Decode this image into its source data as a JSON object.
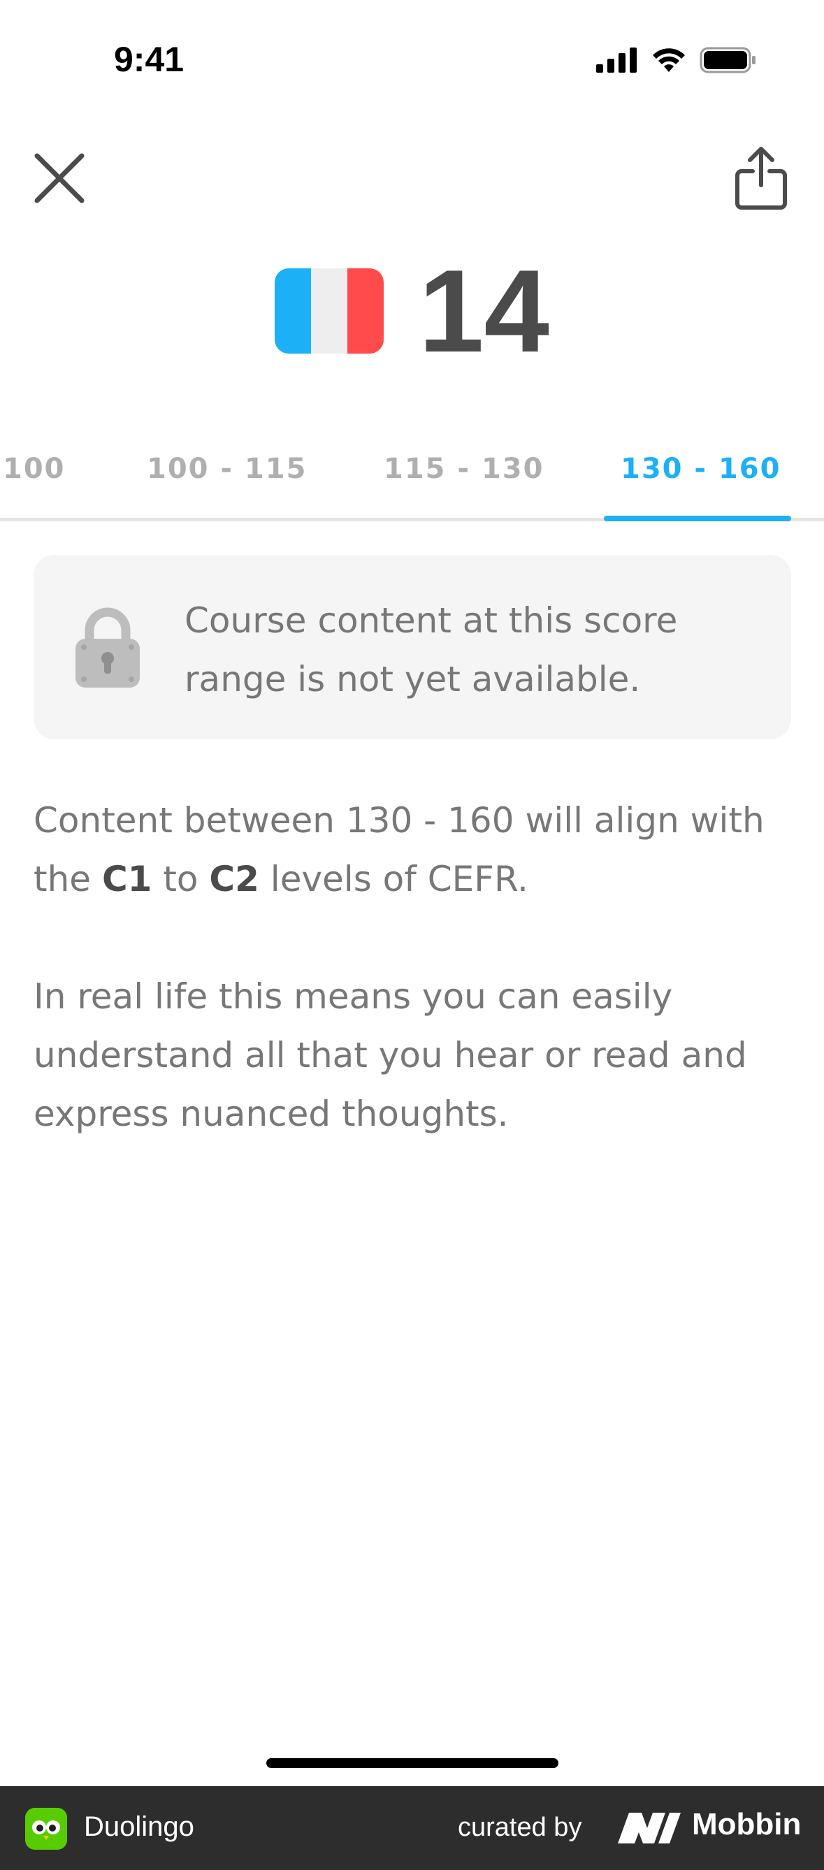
{
  "status_bar": {
    "time": "9:41"
  },
  "header": {
    "flag_colors": [
      "#1cb0f6",
      "#eeeeee",
      "#ff4b4b"
    ],
    "flag_icon": "france-flag-icon",
    "score": "14"
  },
  "tabs": [
    {
      "label": "100",
      "active": false
    },
    {
      "label": "100 - 115",
      "active": false
    },
    {
      "label": "115 - 130",
      "active": false
    },
    {
      "label": "130 - 160",
      "active": true
    }
  ],
  "notice": {
    "icon": "lock-icon",
    "text": "Course content at this score range is not yet available."
  },
  "content": {
    "para1_prefix": "Content between 130 - 160 will align with the ",
    "level_from": "C1",
    "connector": " to ",
    "level_to": "C2",
    "para1_suffix": " levels of CEFR.",
    "para2": "In real life this means you can easily understand all that you hear or read and express nuanced thoughts."
  },
  "footer": {
    "app_name": "Duolingo",
    "curated_by": "curated by",
    "brand": "Mobbin"
  },
  "colors": {
    "accent": "#1cb0f6",
    "text_dark": "#4b4b4b",
    "text_muted": "#777777",
    "tab_inactive": "#afafaf"
  }
}
